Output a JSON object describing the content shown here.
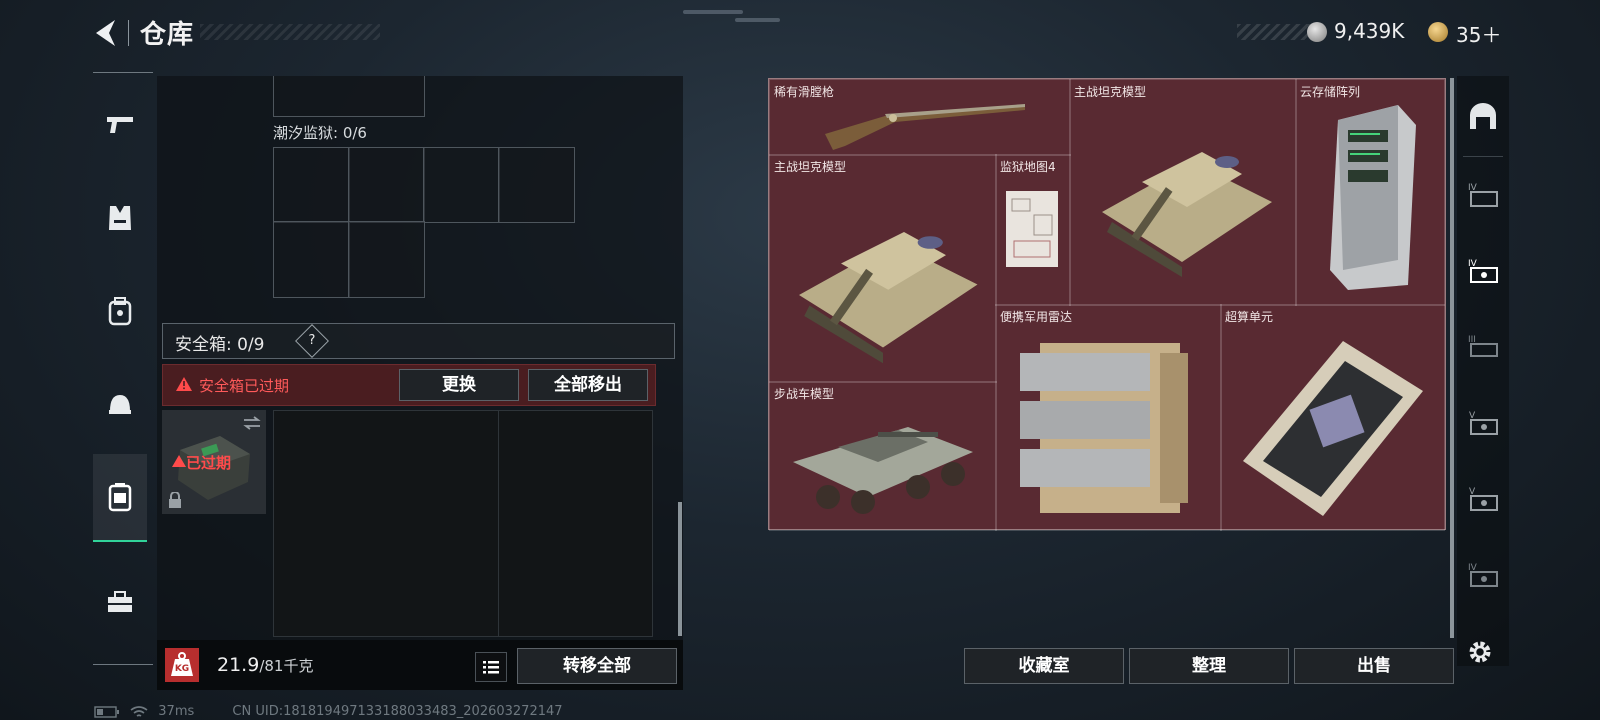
{
  "header": {
    "title": "仓库",
    "currency_silver": "9,439K",
    "currency_gold": "35＋"
  },
  "left_nav": {
    "items": [
      "rifle-icon",
      "vest-icon",
      "backpack-icon",
      "helmet-icon",
      "safebox-icon",
      "toolbox-icon"
    ],
    "active": "safebox-icon"
  },
  "storage": {
    "section_label": "潮汐监狱: 0/6",
    "safebox_label": "安全箱: 0/9",
    "help": "?",
    "warning_text": "安全箱已过期",
    "replace_button": "更换",
    "remove_all_button": "全部移出",
    "case_status": "已过期",
    "weight_value": "21.9",
    "weight_capacity": "/81千克",
    "weight_badge": "KG",
    "transfer_all_button": "转移全部"
  },
  "items": [
    {
      "name": "稀有滑膛枪"
    },
    {
      "name": "主战坦克模型"
    },
    {
      "name": "云存储阵列"
    },
    {
      "name": "主战坦克模型"
    },
    {
      "name": "监狱地图4"
    },
    {
      "name": "便携军用雷达"
    },
    {
      "name": "超算单元"
    },
    {
      "name": "步战车模型"
    }
  ],
  "right_tabs": [
    "hangar-icon",
    "tier-4-icon",
    "tier-4-icon",
    "tier-3-icon",
    "tier-5-icon",
    "tier-5-icon",
    "tier-4-icon"
  ],
  "right_tab_labels": [
    "",
    "IV",
    "IV",
    "III",
    "V",
    "V",
    "IV"
  ],
  "actions": {
    "collection": "收藏室",
    "sort": "整理",
    "sell": "出售"
  },
  "status": {
    "ping": "37ms",
    "uid": "CN UID:18181949713318803348​3_202603272147"
  },
  "colors": {
    "accent": "#31d39a",
    "danger": "#ff4b4b",
    "storage_bg": "#592a32"
  }
}
